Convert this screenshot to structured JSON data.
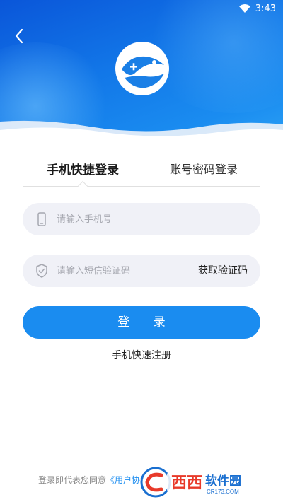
{
  "status_bar": {
    "time": "3:43",
    "wifi_icon": "wifi-icon"
  },
  "header": {
    "back_icon": "chevron-left-icon",
    "logo_icon": "app-logo-icon"
  },
  "tabs": [
    {
      "label": "手机快捷登录",
      "active": true
    },
    {
      "label": "账号密码登录",
      "active": false
    }
  ],
  "phone_field": {
    "placeholder": "请输入手机号",
    "icon": "phone-icon"
  },
  "code_field": {
    "placeholder": "请输入短信验证码",
    "icon": "shield-check-icon",
    "button_label": "获取验证码"
  },
  "login_button": {
    "label": "登 录"
  },
  "register_link": {
    "label": "手机快速注册"
  },
  "agreement": {
    "prefix": "登录即代表您同意",
    "link": "《用户协议》"
  },
  "watermark": {
    "text": "西西软件园",
    "url_text": "CR173.COM"
  },
  "colors": {
    "accent": "#1a8cf0",
    "header_dark": "#0a56d9",
    "field_bg": "#f0f1f7"
  }
}
